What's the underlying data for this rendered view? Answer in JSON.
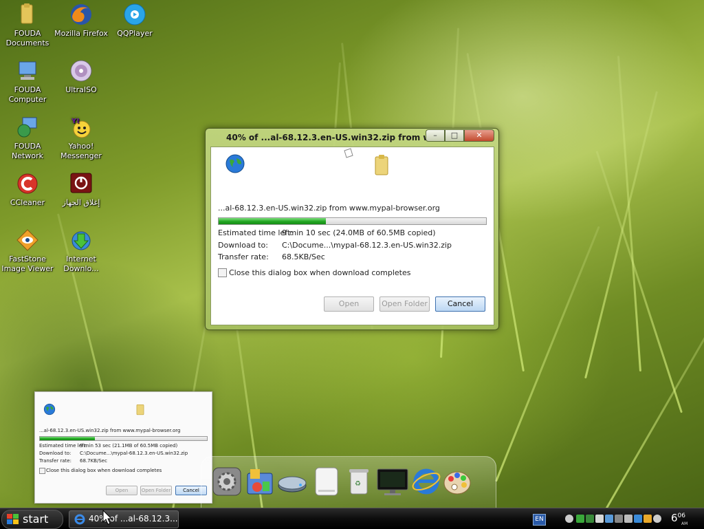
{
  "desktop_icons": [
    {
      "label": "FOUDA Documents",
      "icon": "folder-icon"
    },
    {
      "label": "Mozilla Firefox",
      "icon": "firefox-icon"
    },
    {
      "label": "QQPlayer",
      "icon": "qqplayer-icon"
    },
    {
      "label": "FOUDA Computer",
      "icon": "computer-icon"
    },
    {
      "label": "UltraISO",
      "icon": "disc-icon"
    },
    {
      "label": "FOUDA Network",
      "icon": "network-icon"
    },
    {
      "label": "Yahoo! Messenger",
      "icon": "yahoo-messenger-icon"
    },
    {
      "label": "CCleaner",
      "icon": "ccleaner-icon"
    },
    {
      "label": "إغلاق الجهاز",
      "icon": "power-icon"
    },
    {
      "label": "FastStone Image Viewer",
      "icon": "faststone-icon"
    },
    {
      "label": "Internet Downlo...",
      "icon": "download-manager-icon"
    }
  ],
  "dialog": {
    "title": "40% of ...al-68.12.3.en-US.win32.zip from w...",
    "source": "...al-68.12.3.en-US.win32.zip from www.mypal-browser.org",
    "progress": 0.4,
    "estimated_label": "Estimated time left:",
    "estimated_value": "9 min 10 sec (24.0MB of 60.5MB copied)",
    "download_to_label": "Download to:",
    "download_to_value": "C:\\Docume...\\mypal-68.12.3.en-US.win32.zip",
    "rate_label": "Transfer rate:",
    "rate_value": "68.5KB/Sec",
    "close_checkbox_label": "Close this dialog box when download completes",
    "open_label": "Open",
    "open_folder_label": "Open Folder",
    "cancel_label": "Cancel"
  },
  "thumbnail": {
    "source": "...al-68.12.3.en-US.win32.zip from www.mypal-browser.org",
    "progress": 0.33,
    "estimated_label": "Estimated time left:",
    "estimated_value": "9 min 53 sec (21.1MB of 60.5MB copied)",
    "download_to_label": "Download to:",
    "download_to_value": "C:\\Docume...\\mypal-68.12.3.en-US.win32.zip",
    "rate_label": "Transfer rate:",
    "rate_value": "68.7KB/Sec",
    "close_checkbox_label": "Close this dialog box when download completes",
    "open_label": "Open",
    "open_folder_label": "Open Folder",
    "cancel_label": "Cancel"
  },
  "taskbar": {
    "start_label": "start",
    "task_label": "40% of ...al-68.12.3...",
    "language": "EN",
    "clock_hour": "6",
    "clock_minutes": "06",
    "clock_ampm": "AM"
  },
  "colors": {
    "progress_fill": "#22a622",
    "cancel_border": "#3c6fae"
  }
}
